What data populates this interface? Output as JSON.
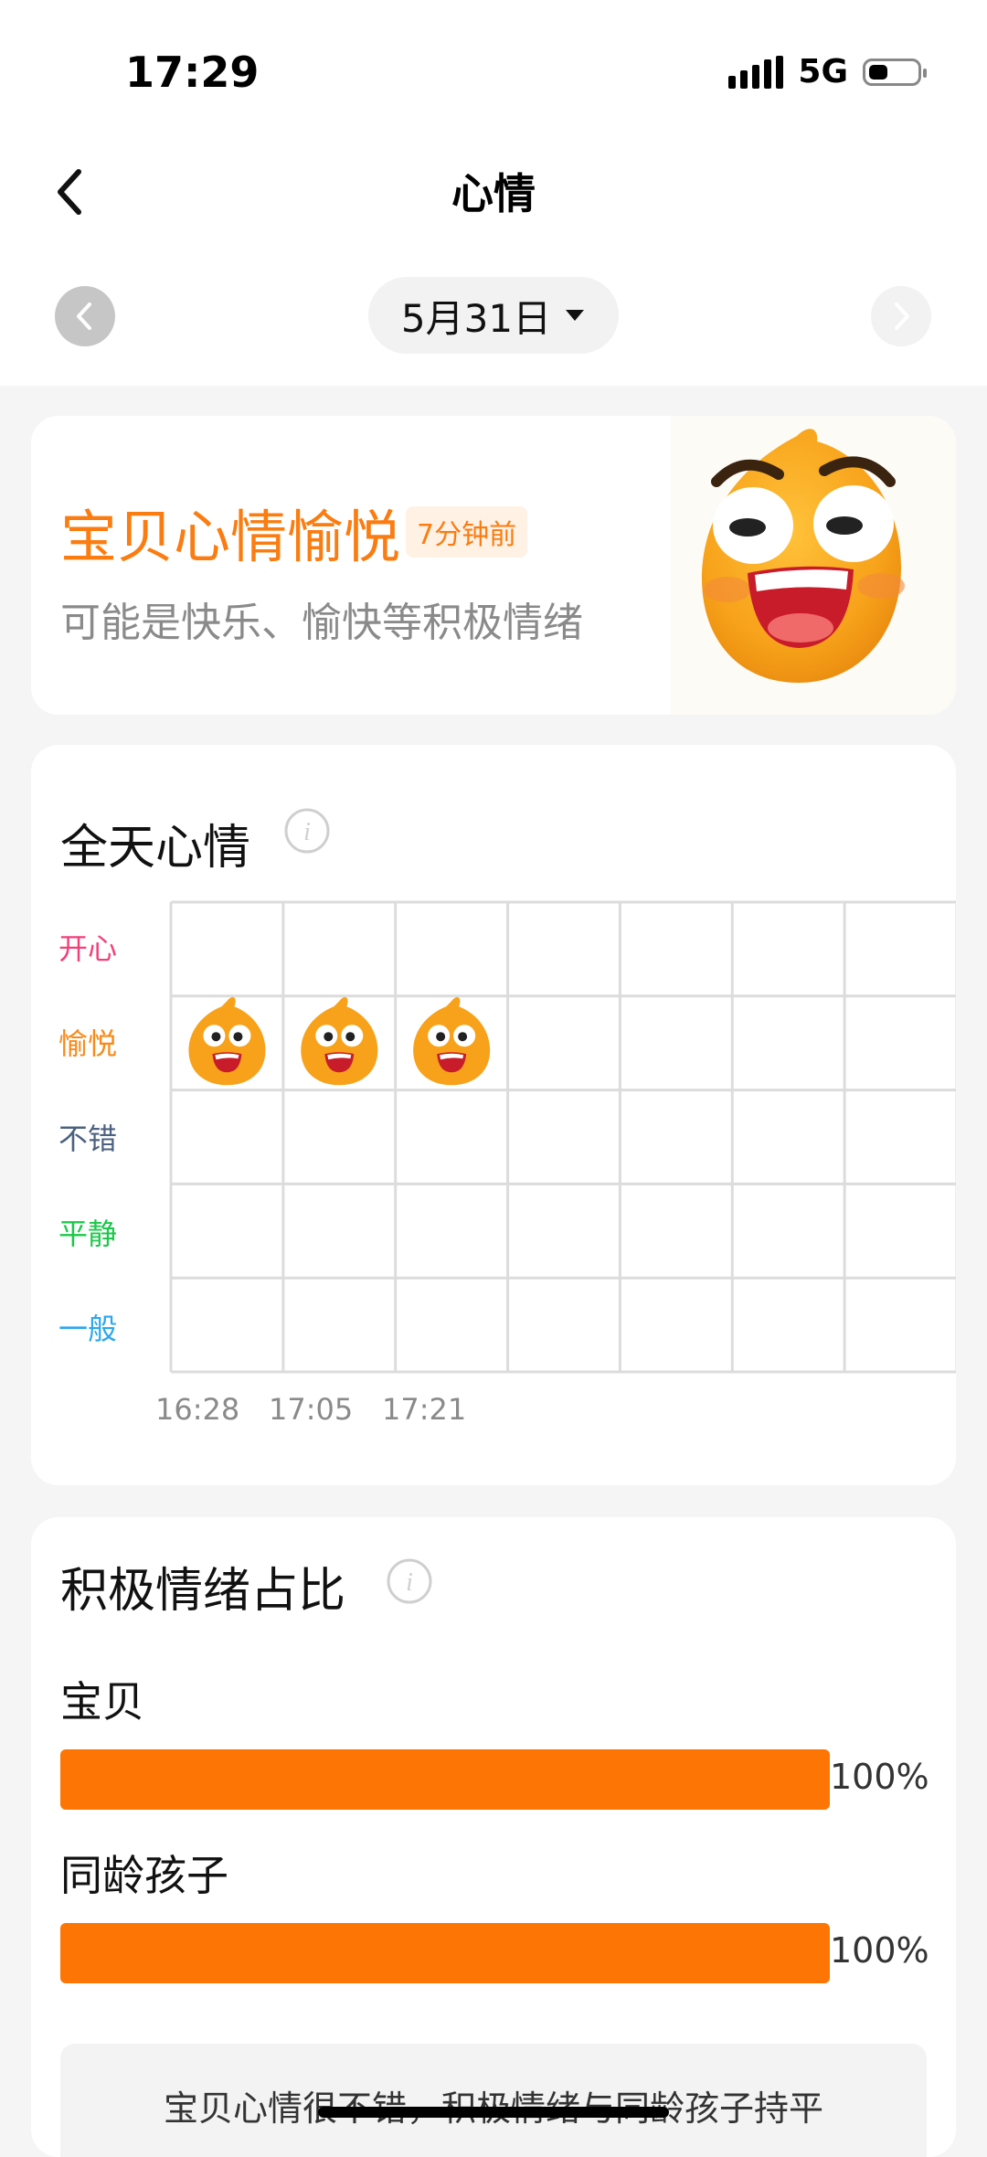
{
  "status_bar": {
    "time": "17:29",
    "network": "5G"
  },
  "header": {
    "title": "心情"
  },
  "date_nav": {
    "date": "5月31日"
  },
  "mood_card": {
    "title": "宝贝心情愉悦",
    "badge": "7分钟前",
    "subtitle": "可能是快乐、愉快等积极情绪",
    "mascot_icon": "smiling-mascot-icon"
  },
  "daily_mood": {
    "title": "全天心情",
    "levels": [
      {
        "label": "开心",
        "color": "#f2417a"
      },
      {
        "label": "愉悦",
        "color": "#f98a1a"
      },
      {
        "label": "不错",
        "color": "#4c6180"
      },
      {
        "label": "平静",
        "color": "#1cc84a"
      },
      {
        "label": "一般",
        "color": "#2aa7f0"
      }
    ],
    "entries": [
      {
        "time": "16:28",
        "level": "愉悦"
      },
      {
        "time": "17:05",
        "level": "愉悦"
      },
      {
        "time": "17:21",
        "level": "愉悦"
      }
    ]
  },
  "positive_ratio": {
    "title": "积极情绪占比",
    "rows": [
      {
        "label": "宝贝",
        "percent_text": "100%",
        "value": 1.0
      },
      {
        "label": "同龄孩子",
        "percent_text": "100%",
        "value": 1.0
      }
    ],
    "summary": "宝贝心情很不错，积极情绪与同龄孩子持平"
  },
  "colors": {
    "accent": "#fd7504",
    "mood_title": "#fb7c10"
  }
}
